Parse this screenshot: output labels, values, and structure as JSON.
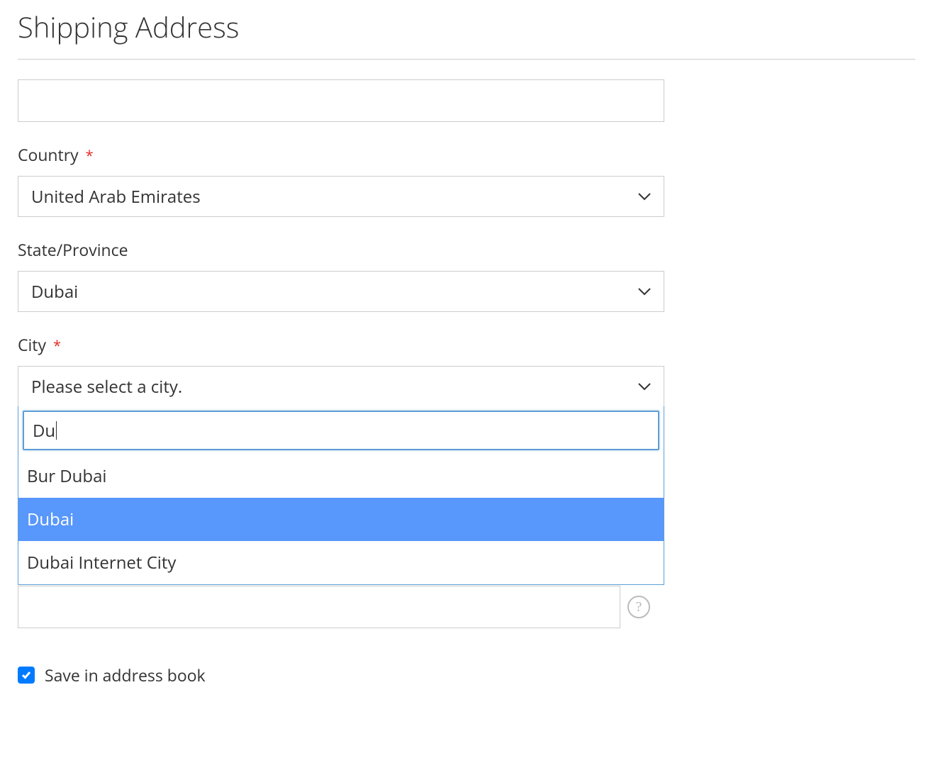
{
  "header": {
    "title": "Shipping Address"
  },
  "form": {
    "unlabeled_input": {
      "value": ""
    },
    "country": {
      "label": "Country",
      "required": true,
      "selected": "United Arab Emirates"
    },
    "state": {
      "label": "State/Province",
      "required": false,
      "selected": "Dubai"
    },
    "city": {
      "label": "City",
      "required": true,
      "placeholder": "Please select a city.",
      "search_value": "Du",
      "options": [
        {
          "label": "Bur Dubai",
          "highlighted": false
        },
        {
          "label": "Dubai",
          "highlighted": true
        },
        {
          "label": "Dubai Internet City",
          "highlighted": false
        }
      ]
    },
    "hidden_field": {
      "value": ""
    },
    "save_checkbox": {
      "label": "Save in address book",
      "checked": true
    }
  },
  "icons": {
    "help": "?"
  }
}
